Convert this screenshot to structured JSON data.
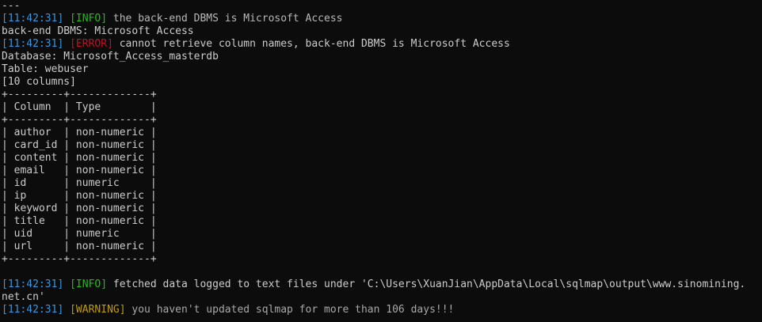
{
  "terminal": {
    "first_line": "---",
    "log1": {
      "ts": "[11:42:31]",
      "level": "[INFO]",
      "msg": " the back-end DBMS is Microsoft Access"
    },
    "dbms_line": "back-end DBMS: Microsoft Access",
    "log2": {
      "ts": "[11:42:31]",
      "level": "[ERROR]",
      "msg": " cannot retrieve column names, back-end DBMS is Microsoft Access"
    },
    "database_line": "Database: Microsoft_Access_masterdb",
    "table_line": "Table: webuser",
    "columns_count": "[10 columns]",
    "table": {
      "border": "+---------+-------------+",
      "header": "| Column  | Type        |",
      "rows": [
        "| author  | non-numeric |",
        "| card_id | non-numeric |",
        "| content | non-numeric |",
        "| email   | non-numeric |",
        "| id      | numeric     |",
        "| ip      | non-numeric |",
        "| keyword | non-numeric |",
        "| title   | non-numeric |",
        "| uid     | numeric     |",
        "| url     | non-numeric |"
      ]
    },
    "log3": {
      "ts": "[11:42:31]",
      "level": "[INFO]",
      "msg": " fetched data logged to text files under 'C:\\Users\\XuanJian\\AppData\\Local\\sqlmap\\output\\www.sinomining."
    },
    "log3_wrap": "net.cn'",
    "log4": {
      "ts": "[11:42:31]",
      "level": "[WARNING]",
      "msg": " you haven't updated sqlmap for more than 106 days!!!"
    }
  },
  "colors": {
    "background": "#0c0c0c",
    "text": "#cccccc",
    "timestamp": "#3a96dd",
    "info": "#16c60c",
    "error": "#c50f1f",
    "warning": "#c19c00"
  }
}
